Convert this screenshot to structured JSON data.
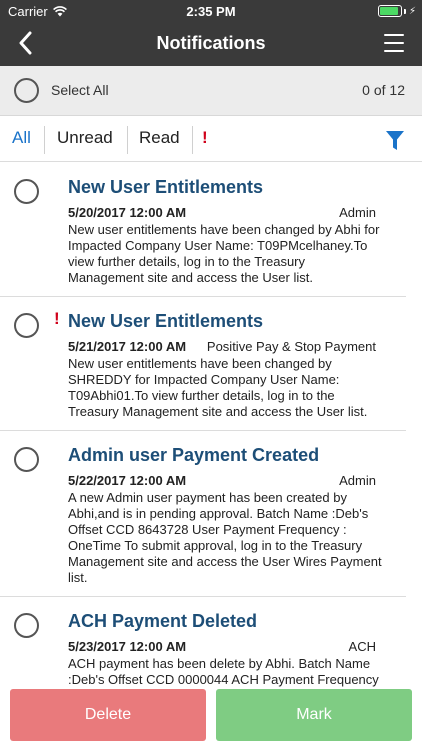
{
  "status_bar": {
    "carrier": "Carrier",
    "time": "2:35 PM",
    "battery_percent": 90
  },
  "nav": {
    "title": "Notifications",
    "back_icon": "chevron-left-icon",
    "menu_icon": "hamburger-menu-icon"
  },
  "select_bar": {
    "select_all_label": "Select All",
    "count": "0 of 12"
  },
  "filters": {
    "all": "All",
    "unread": "Unread",
    "read": "Read",
    "important": "!",
    "active": "All",
    "filter_icon": "funnel-icon"
  },
  "notifications": [
    {
      "title": "New User Entitlements",
      "date": "5/20/2017 12:00 AM",
      "type": "Admin",
      "important": false,
      "body": "New user entitlements have been changed by Abhi for Impacted Company User Name: T09PMcelhaney.To view further details, log in to the Treasury Management site and access the User list."
    },
    {
      "title": "New User Entitlements",
      "date": "5/21/2017 12:00 AM",
      "type": "Positive Pay & Stop Payment",
      "important": true,
      "flag": "!",
      "body": "New user entitlements have been changed by SHREDDY for Impacted Company User Name: T09Abhi01.To view further details, log in to the Treasury Management site and access the User list."
    },
    {
      "title": "Admin user Payment Created",
      "date": "5/22/2017 12:00 AM",
      "type": "Admin",
      "important": false,
      "body": "A new Admin user payment has been created by Abhi,and is in pending approval. Batch Name :Deb's Offset CCD 8643728 User Payment Frequency : OneTime To submit approval, log in to the Treasury Management site and access the User Wires Payment list."
    },
    {
      "title": "ACH Payment Deleted",
      "date": "5/23/2017 12:00 AM",
      "type": "ACH",
      "important": false,
      "body": "ACH payment has been delete by Abhi. Batch Name :Deb's Offset CCD 0000044 ACH Payment Frequency : Log in to the Treasury Management site"
    }
  ],
  "actions": {
    "delete_label": "Delete",
    "mark_label": "Mark"
  },
  "colors": {
    "header_bg": "#3a3a3a",
    "accent_blue": "#1a73c9",
    "title_blue": "#1d4e77",
    "alert_red": "#d0021b",
    "delete_bg": "#e97a7c",
    "mark_bg": "#7fcc83"
  }
}
